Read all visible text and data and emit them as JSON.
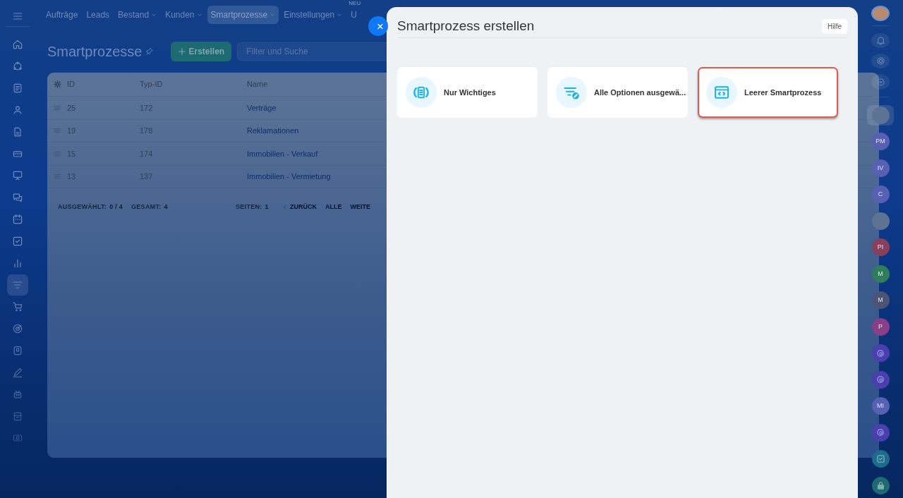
{
  "top_nav": [
    {
      "label": "Aufträge",
      "dropdown": false,
      "selected": false
    },
    {
      "label": "Leads",
      "dropdown": false,
      "selected": false
    },
    {
      "label": "Bestand",
      "dropdown": true,
      "selected": false
    },
    {
      "label": "Kunden",
      "dropdown": true,
      "selected": false
    },
    {
      "label": "Smartprozesse",
      "dropdown": true,
      "selected": true
    },
    {
      "label": "Einstellungen",
      "dropdown": true,
      "selected": false
    },
    {
      "label": "U",
      "badge": "NEU",
      "dropdown": false,
      "selected": false
    }
  ],
  "left_sidebar": [
    {
      "selected": false
    },
    {
      "selected": false
    },
    {
      "selected": false
    },
    {
      "selected": false
    },
    {
      "selected": false
    },
    {
      "selected": false
    },
    {
      "selected": false
    },
    {
      "selected": false
    },
    {
      "selected": false
    },
    {
      "selected": false
    },
    {
      "selected": false
    },
    {
      "selected": true
    },
    {
      "selected": false
    },
    {
      "selected": false
    },
    {
      "selected": false
    },
    {
      "selected": false
    },
    {
      "selected": false
    },
    {
      "selected": false
    },
    {
      "selected": false
    }
  ],
  "page": {
    "title": "Smartprozesse",
    "create_button": "Erstellen",
    "search": {
      "placeholder": "Filter und Suche"
    }
  },
  "table": {
    "columns": [
      "ID",
      "Typ-ID",
      "Name"
    ],
    "rows": [
      [
        "25",
        "172",
        "Verträge"
      ],
      [
        "19",
        "178",
        "Reklamationen"
      ],
      [
        "15",
        "174",
        "Immobilien - Verkauf"
      ],
      [
        "13",
        "137",
        "Immobilien - Vermietung"
      ]
    ],
    "footer": {
      "selected_label": "AUSGEWÄHLT:",
      "selected_value": "0 / 4",
      "total_label": "GESAMT:",
      "total_value": "4",
      "pages_label": "SEITEN:",
      "pages_value": "1",
      "prev": "ZURÜCK",
      "all": "ALLE",
      "next": "WEITE"
    }
  },
  "panel": {
    "title": "Smartprozess erstellen",
    "help_button": "Hilfe",
    "options": [
      {
        "label": "Nur Wichtiges",
        "kind": "doc",
        "selected": false
      },
      {
        "label": "Alle Optionen ausgewä...",
        "kind": "filter",
        "selected": false
      },
      {
        "label": "Leerer Smartprozess",
        "kind": "code",
        "selected": true
      }
    ]
  },
  "right_sidebar": {
    "chats": [
      {
        "kind": "photo",
        "selected": true
      },
      {
        "kind": "initials",
        "text": "PM",
        "color": "#5860b4",
        "selected": false
      },
      {
        "kind": "initials",
        "text": "IV",
        "color": "#5860b4",
        "selected": false
      },
      {
        "kind": "initials",
        "text": "C",
        "color": "#5860b4",
        "selected": false
      },
      {
        "kind": "photo",
        "selected": false
      },
      {
        "kind": "initials",
        "text": "PI",
        "color": "#8a3f5c",
        "selected": false
      },
      {
        "kind": "initials",
        "text": "M",
        "color": "#2f7d5c",
        "selected": false
      },
      {
        "kind": "initials",
        "text": "M",
        "color": "#4e5475",
        "selected": false
      },
      {
        "kind": "initials",
        "text": "P",
        "color": "#883f88",
        "selected": false
      },
      {
        "kind": "app",
        "selected": false
      },
      {
        "kind": "app",
        "selected": false
      },
      {
        "kind": "initials",
        "text": "MI",
        "color": "#5860b4",
        "selected": false
      },
      {
        "kind": "app",
        "selected": false
      },
      {
        "kind": "task",
        "selected": false
      },
      {
        "kind": "lock",
        "selected": false
      }
    ]
  }
}
